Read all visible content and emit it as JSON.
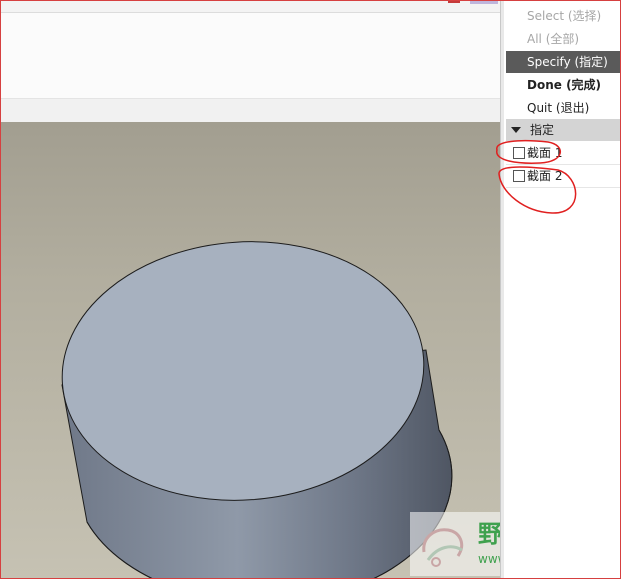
{
  "menu": {
    "items": [
      {
        "label": "Select (选择)",
        "state": "disabled"
      },
      {
        "label": "All (全部)",
        "state": "disabled"
      },
      {
        "label": "Specify (指定)",
        "state": "selected"
      },
      {
        "label": "Done (完成)",
        "state": "bold"
      },
      {
        "label": "Quit (退出)",
        "state": "normal"
      }
    ]
  },
  "section": {
    "title": "指定",
    "items": [
      {
        "label": "截面 1",
        "checked": false
      },
      {
        "label": "截面 2",
        "checked": false
      }
    ]
  },
  "watermark": {
    "title": "野火论坛",
    "url": "www.proewildfire.cn"
  },
  "colors": {
    "selected_bg": "#5a5a5a",
    "section_bg": "#d4d4d4",
    "annotation_red": "#e02020",
    "watermark_green": "#3fa14e",
    "model_top": "#a7b1bf"
  }
}
